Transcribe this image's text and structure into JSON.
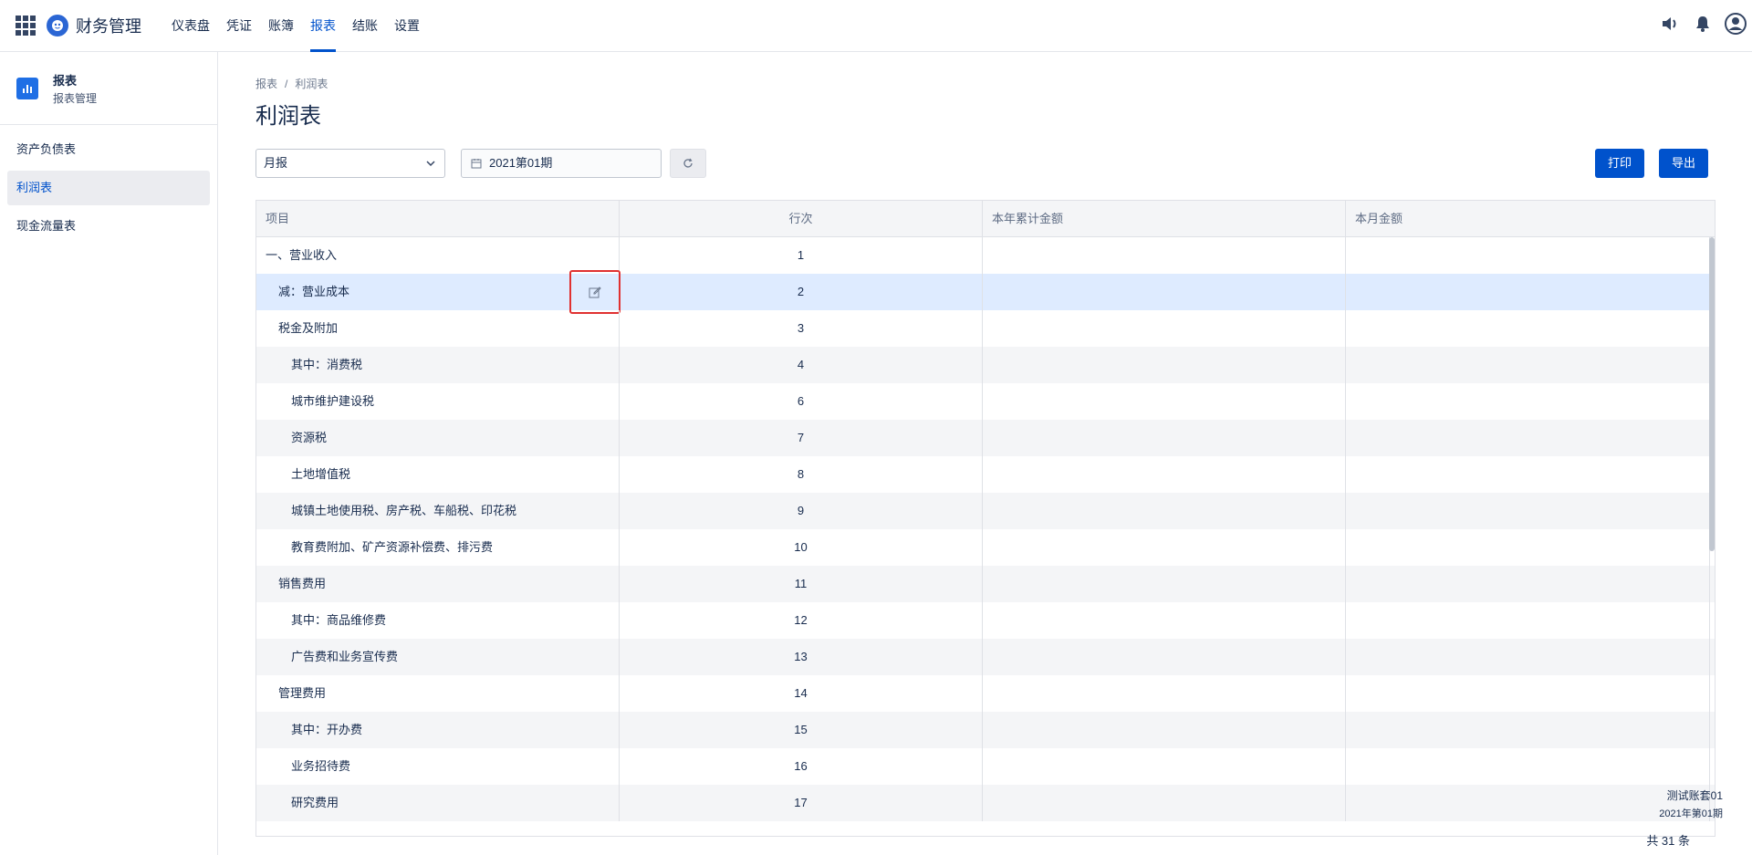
{
  "app": {
    "title": "财务管理"
  },
  "nav": [
    "仪表盘",
    "凭证",
    "账簿",
    "报表",
    "结账",
    "设置"
  ],
  "nav_active": "报表",
  "top_icons": [
    "speaker-icon",
    "bell-icon",
    "user-avatar-icon"
  ],
  "sidebar": {
    "header_title": "报表",
    "header_subtitle": "报表管理",
    "items": [
      "资产负债表",
      "利润表",
      "现金流量表"
    ],
    "active": "利润表"
  },
  "breadcrumb": [
    "报表",
    "利润表"
  ],
  "page_title": "利润表",
  "filters": {
    "period_type": "月报",
    "period": "2021第01期"
  },
  "buttons": {
    "print": "打印",
    "export": "导出"
  },
  "table": {
    "headers": [
      "项目",
      "行次",
      "本年累计金额",
      "本月金额"
    ],
    "rows": [
      {
        "item": "一、营业收入",
        "line": "1"
      },
      {
        "item": "减：营业成本",
        "line": "2"
      },
      {
        "item": "税金及附加",
        "line": "3"
      },
      {
        "item": "其中：消费税",
        "line": "4"
      },
      {
        "item": "城市维护建设税",
        "line": "6"
      },
      {
        "item": "资源税",
        "line": "7"
      },
      {
        "item": "土地增值税",
        "line": "8"
      },
      {
        "item": "城镇土地使用税、房产税、车船税、印花税",
        "line": "9"
      },
      {
        "item": "教育费附加、矿产资源补偿费、排污费",
        "line": "10"
      },
      {
        "item": "销售费用",
        "line": "11"
      },
      {
        "item": "其中：商品维修费",
        "line": "12"
      },
      {
        "item": "广告费和业务宣传费",
        "line": "13"
      },
      {
        "item": "管理费用",
        "line": "14"
      },
      {
        "item": "其中：开办费",
        "line": "15"
      },
      {
        "item": "业务招待费",
        "line": "16"
      },
      {
        "item": "研究费用",
        "line": "17"
      }
    ]
  },
  "footer": {
    "account_set": "测试账套01",
    "period": "2021年第01期",
    "total": "共 31 条"
  }
}
